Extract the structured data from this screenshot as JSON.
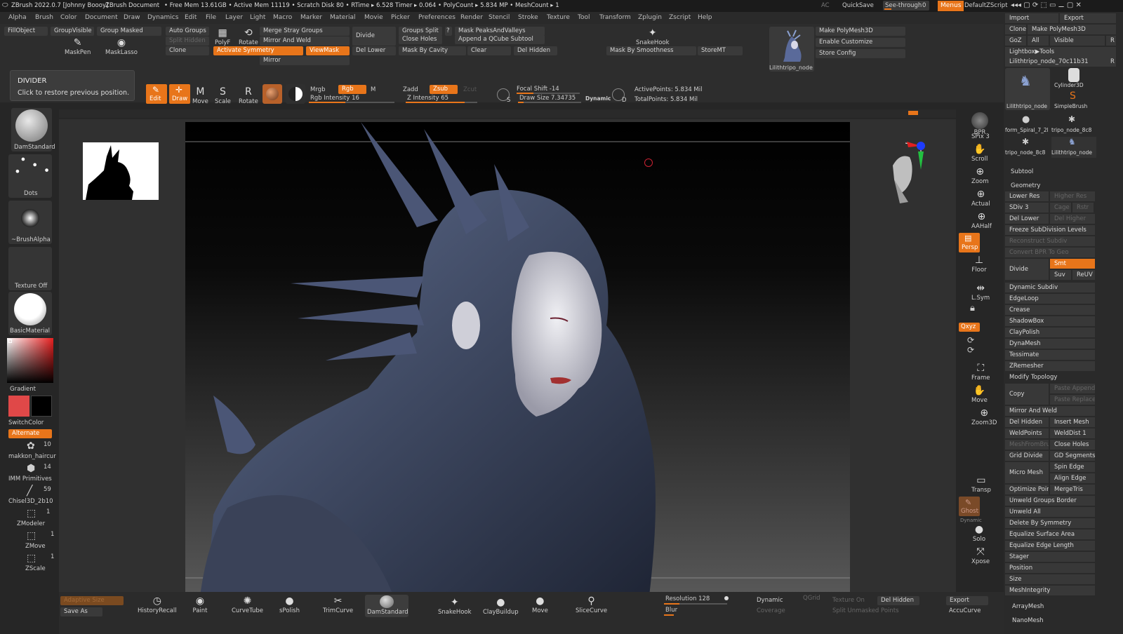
{
  "titlebar": {
    "app": "ZBrush 2022.0.7 [Johnny Boooy]",
    "doc": "ZBrush Document",
    "stats": "• Free Mem 13.61GB • Active Mem 11119 • Scratch Disk 80 • RTime ▸ 6.528 Timer ▸ 0.064 • PolyCount ▸ 5.834 MP • MeshCount ▸ 1",
    "ac": "AC",
    "quicksave": "QuickSave",
    "seethrough": "See-through",
    "seethrough_val": "0",
    "menus": "Menus",
    "script": "DefaultZScript"
  },
  "menu": [
    "Alpha",
    "Brush",
    "Color",
    "Document",
    "Draw",
    "Dynamics",
    "Edit",
    "File",
    "Layer",
    "Light",
    "Macro",
    "Marker",
    "Material",
    "Movie",
    "Picker",
    "Preferences",
    "Render",
    "Stencil",
    "Stroke",
    "Texture",
    "Tool",
    "Transform",
    "Zplugin",
    "Zscript",
    "Help"
  ],
  "topshelf": {
    "fillobject": "FillObject",
    "groupvisible": "GroupVisible",
    "groupmasked": "Group Masked",
    "autogroups": "Auto Groups",
    "splithidden": "Split Hidden",
    "clone": "Clone",
    "activatesym": "Activate Symmetry",
    "viewmask": "ViewMask",
    "mergestray": "Merge Stray Groups",
    "mirrorweld": "Mirror And Weld",
    "mirror": "Mirror",
    "divide": "Divide",
    "dellower": "Del Lower",
    "groupssplit": "Groups Split",
    "closeholes": "Close Holes",
    "maskbycavity": "Mask By Cavity",
    "clear": "Clear",
    "maskpeaks": "Mask PeaksAndValleys",
    "appendqcube": "Append a QCube Subtool",
    "delhidden": "Del Hidden",
    "maskbysmooth": "Mask By Smoothness",
    "storemt": "StoreMT",
    "snakehook": "SnakeHook",
    "makepolymesh": "Make PolyMesh3D",
    "enablecustom": "Enable Customize",
    "storeconfig": "Store Config",
    "thumbname": "Lilithtripo_node",
    "maskpen": "MaskPen",
    "masklasso": "MaskLasso",
    "polyf": "PolyF",
    "rotate": "Rotate",
    "question": "?"
  },
  "tooltip": {
    "title": "DIVIDER",
    "text": "Click to restore previous position."
  },
  "drawbar": {
    "edit": "Edit",
    "draw": "Draw",
    "move": "Move",
    "scale": "Scale",
    "rotate": "Rotate",
    "mrgb": "Mrgb",
    "rgb": "Rgb",
    "m": "M",
    "rgbint": "Rgb Intensity 16",
    "zadd": "Zadd",
    "zsub": "Zsub",
    "zcut": "Zcut",
    "zint": "Z Intensity 65",
    "focal": "Focal Shift -14",
    "drawsize": "Draw Size 7.34735",
    "dynamic": "Dynamic",
    "s": "S",
    "d": "D",
    "activepoints": "ActivePoints: 5.834 Mil",
    "totalpoints": "TotalPoints: 5.834 Mil"
  },
  "left": {
    "brush": "DamStandard",
    "stroke": "Dots",
    "alpha": "~BrushAlpha",
    "texture": "Texture Off",
    "material": "BasicMaterial",
    "gradient": "Gradient",
    "switchcolor": "SwitchColor",
    "alternate": "Alternate",
    "tools": [
      {
        "name": "makkon_haircur",
        "count": "10"
      },
      {
        "name": "IMM Primitives",
        "count": "14"
      },
      {
        "name": "Chisel3D_2b10",
        "count": "59"
      },
      {
        "name": "ZModeler",
        "count": "1"
      },
      {
        "name": "ZMove",
        "count": "1"
      },
      {
        "name": "ZScale",
        "count": "1"
      }
    ],
    "colors": {
      "main": "#e04848",
      "secondary": "#000000"
    }
  },
  "rightshelf": [
    "BPR",
    "SPix 3",
    "Scroll",
    "Zoom",
    "Actual",
    "AAHalf",
    "Persp",
    "Floor",
    "L.Sym",
    "Qxyz",
    "Frame",
    "Move",
    "Zoom3D",
    "Transp",
    "Ghost",
    "Dynamic",
    "Solo",
    "Xpose"
  ],
  "bottom": {
    "adaptive": "Adaptive Size",
    "saveas": "Save As",
    "items": [
      "HistoryRecall",
      "Paint",
      "CurveTube",
      "sPolish",
      "TrimCurve",
      "DamStandard",
      "SnakeHook",
      "ClayBuildup",
      "Move",
      "SliceCurve"
    ],
    "resolution": "Resolution 128",
    "blur": "Blur",
    "dynamic": "Dynamic",
    "qgrid": "QGrid",
    "coverage": "Coverage",
    "textureon": "Texture On",
    "delhidden": "Del Hidden",
    "splitunmasked": "Split Unmasked Points",
    "export": "Export",
    "accucurve": "AccuCurve"
  },
  "rpanel": {
    "import": "Import",
    "export": "Export",
    "clone": "Clone",
    "makepoly": "Make PolyMesh3D",
    "goz": "GoZ",
    "all": "All",
    "visible": "Visible",
    "r": "R",
    "lightbox": "Lightbox▶Tools",
    "toolname": "Lilithtripo_node_70c11b31",
    "tools": [
      "Lilithtripo_node",
      "Cylinder3D",
      "SimpleBrush",
      "form_Spiral_7_2l",
      "tripo_node_8c8",
      "tripo_node_8c8",
      "Lilithtripo_node"
    ],
    "subtool": "Subtool",
    "geometry": "Geometry",
    "lowerres": "Lower Res",
    "higherres": "Higher Res",
    "sdiv": "SDiv 3",
    "cage": "Cage",
    "rstr": "Rstr",
    "dellower": "Del Lower",
    "delhigher": "Del Higher",
    "freeze": "Freeze SubDivision Levels",
    "reconstruct": "Reconstruct Subdiv",
    "convertbpr": "Convert BPR To Geo",
    "divide": "Divide",
    "smt": "Smt",
    "suv": "Suv",
    "reuv": "ReUV",
    "list1": [
      "Dynamic Subdiv",
      "EdgeLoop",
      "Crease",
      "ShadowBox",
      "ClayPolish",
      "DynaMesh",
      "Tessimate",
      "ZRemesher"
    ],
    "modtopo": "Modify Topology",
    "copy": "Copy",
    "pasteappend": "Paste Append",
    "pastereplace": "Paste Replace",
    "mirrorweld": "Mirror And Weld",
    "delhidden": "Del Hidden",
    "insertmesh": "Insert Mesh",
    "weldpoints": "WeldPoints",
    "welddist": "WeldDist 1",
    "meshfrombrush": "MeshFromBrush",
    "closeholes": "Close Holes",
    "griddivide": "Grid Divide",
    "gdsegments": "GD Segments",
    "micromesh": "Micro Mesh",
    "spinedge": "Spin Edge",
    "alignedge": "Align Edge",
    "optimize": "Optimize Points",
    "mergetris": "MergeTris",
    "list2": [
      "Unweld Groups Border",
      "Unweld All",
      "Delete By Symmetry",
      "Equalize Surface Area",
      "Equalize Edge Length"
    ],
    "list3": [
      "Stager",
      "Position",
      "Size",
      "MeshIntegrity"
    ],
    "arraymesh": "ArrayMesh",
    "nanomesh": "NanoMesh"
  }
}
